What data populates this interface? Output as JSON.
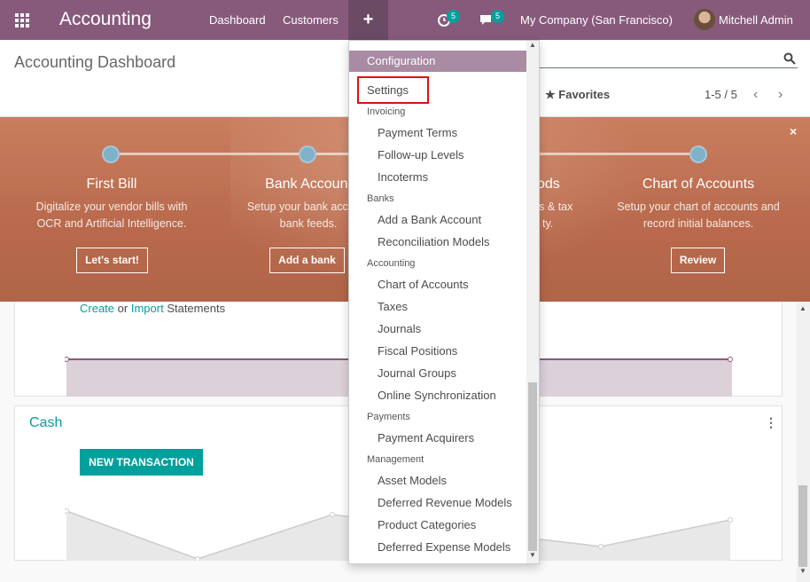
{
  "navbar": {
    "app_name": "Accounting",
    "menu_dashboard": "Dashboard",
    "menu_customers": "Customers",
    "plus_label": "+",
    "activity_count": "5",
    "messages_count": "5",
    "company": "My Company (San Francisco)",
    "user": "Mitchell Admin"
  },
  "control": {
    "title": "Accounting Dashboard",
    "favorites": "Favorites",
    "pager": "1-5 / 5",
    "prev_icon": "chevron-left-icon",
    "next_icon": "chevron-right-icon"
  },
  "banner": {
    "steps": [
      {
        "title": "First Bill",
        "desc1": "Digitalize your vendor bills with",
        "desc2": "OCR and Artificial Intelligence.",
        "button": "Let's start!"
      },
      {
        "title": "Bank Account",
        "desc1": "Setup your bank account",
        "desc2": "bank feeds.",
        "button": "Add a bank"
      },
      {
        "title": "ods",
        "desc1": "rs & tax",
        "desc2": "ty."
      },
      {
        "title": "Chart of Accounts",
        "desc1": "Setup your chart of accounts and",
        "desc2": "record initial balances.",
        "button": "Review"
      }
    ],
    "close": "×",
    "colors": {
      "dot": "#7fb1c9",
      "background": "#c97e5e"
    }
  },
  "bank_card": {
    "create": "Create",
    "or": "or",
    "import": "Import",
    "statements": "Statements"
  },
  "cash_card": {
    "name": "Cash",
    "new_transaction": "NEW TRANSACTION",
    "kebab": "⋮"
  },
  "dropdown": {
    "header": "Configuration",
    "settings": "Settings",
    "sections": {
      "invoicing": "Invoicing",
      "banks": "Banks",
      "accounting": "Accounting",
      "payments": "Payments",
      "management": "Management"
    },
    "items": {
      "payment_terms": "Payment Terms",
      "followup_levels": "Follow-up Levels",
      "incoterms": "Incoterms",
      "add_bank_account": "Add a Bank Account",
      "reconciliation_models": "Reconciliation Models",
      "chart_of_accounts": "Chart of Accounts",
      "taxes": "Taxes",
      "journals": "Journals",
      "fiscal_positions": "Fiscal Positions",
      "journal_groups": "Journal Groups",
      "online_sync": "Online Synchronization",
      "payment_acquirers": "Payment Acquirers",
      "asset_models": "Asset Models",
      "deferred_revenue_models": "Deferred Revenue Models",
      "product_categories": "Product Categories",
      "deferred_expense_models": "Deferred Expense Models"
    }
  },
  "colors": {
    "brand": "#875a7b",
    "accent": "#00a09d",
    "highlight_box": "#dd1111"
  }
}
